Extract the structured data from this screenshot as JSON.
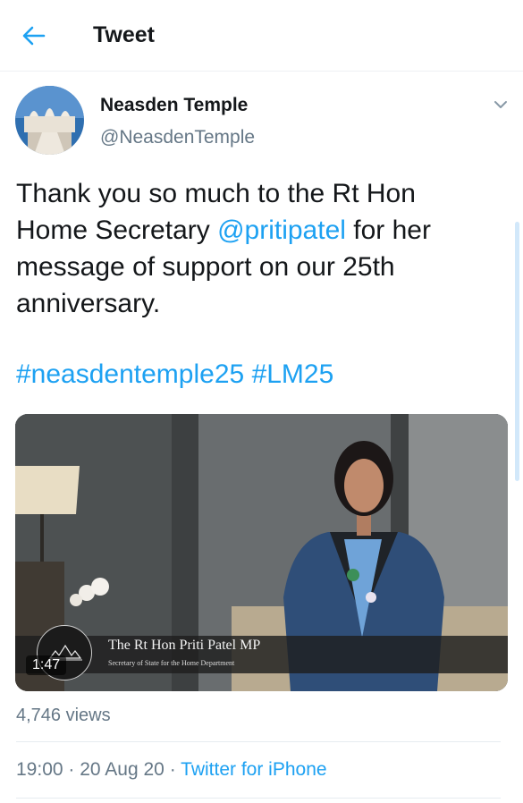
{
  "header": {
    "title": "Tweet"
  },
  "tweet": {
    "display_name": "Neasden Temple",
    "handle": "@NeasdenTemple",
    "text": {
      "l1": "Thank you so much to the Rt Hon",
      "l2_pre": "Home Secretary ",
      "mention": "@pritipatel",
      "l2_post": " for her",
      "l3": "message of support on our 25th",
      "l4": "anniversary."
    },
    "hashtags": [
      "#neasdentemple25",
      "#LM25"
    ],
    "video": {
      "duration": "1:47",
      "caption_name": "The Rt Hon Priti Patel MP",
      "caption_role": "Secretary of State for the Home Department"
    },
    "views": "4,746 views",
    "time": "19:00",
    "date": "20 Aug 20",
    "separator": "·",
    "source": "Twitter for iPhone"
  },
  "colors": {
    "accent": "#1da1f2",
    "secondary_text": "#657786",
    "primary_text": "#14171a"
  },
  "icons": {
    "back": "arrow-left-icon",
    "more": "chevron-down-icon"
  }
}
